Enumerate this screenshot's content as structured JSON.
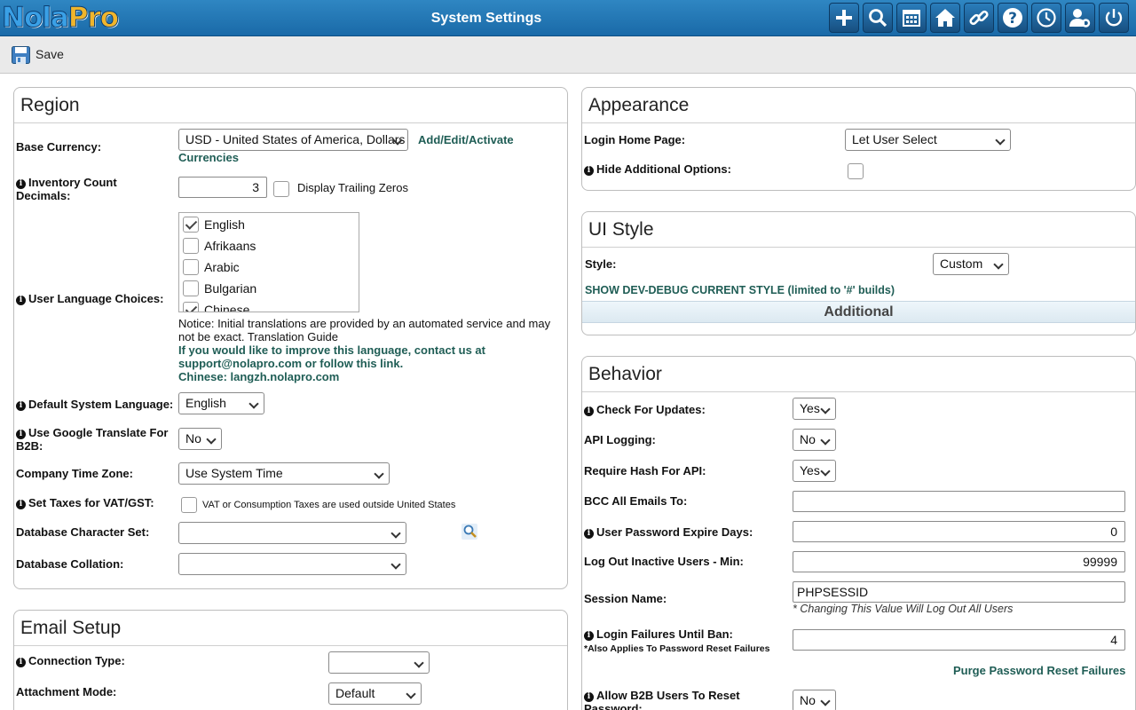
{
  "header": {
    "logo_part1": "Nola",
    "logo_part2": "Pro",
    "title": "System Settings",
    "icons": [
      "plus-icon",
      "search-icon",
      "calendar-icon",
      "home-icon",
      "link-icon",
      "help-icon",
      "clock-icon",
      "user-settings-icon",
      "power-icon"
    ]
  },
  "toolbar": {
    "save_label": "Save"
  },
  "region": {
    "title": "Region",
    "base_currency_label": "Base Currency:",
    "base_currency_value": "USD - United States of America, Dollars",
    "currencies_link_1": "Add/Edit/Activate",
    "currencies_link_2": "Currencies",
    "inventory_label_1": "Inventory Count",
    "inventory_label_2": "Decimals:",
    "inventory_value": "3",
    "trailing_zeros_label": "Display Trailing Zeros",
    "user_lang_label": "User Language Choices:",
    "languages": [
      {
        "name": "English",
        "checked": true
      },
      {
        "name": "Afrikaans",
        "checked": false
      },
      {
        "name": "Arabic",
        "checked": false
      },
      {
        "name": "Bulgarian",
        "checked": false
      },
      {
        "name": "Chinese",
        "checked": true
      }
    ],
    "notice_1": "Notice: Initial translations are provided by an automated service and may",
    "notice_2": "not be exact. Translation Guide",
    "improve_1": "If you would like to improve this language, contact us at",
    "improve_2": "support@nolapro.com or follow this link.",
    "improve_3": "Chinese: langzh.nolapro.com",
    "default_lang_label": "Default System Language:",
    "default_lang_value": "English",
    "google_label_1": "Use Google Translate For",
    "google_label_2": "B2B:",
    "google_value": "No",
    "timezone_label": "Company Time Zone:",
    "timezone_value": "Use System Time",
    "vat_label": "Set Taxes for VAT/GST:",
    "vat_note": "VAT or Consumption Taxes are used outside United States",
    "charset_label": "Database Character Set:",
    "charset_value": "",
    "collation_label": "Database Collation:",
    "collation_value": ""
  },
  "email": {
    "title": "Email Setup",
    "conn_label": "Connection Type:",
    "conn_value": "",
    "attach_label": "Attachment Mode:",
    "attach_value": "Default"
  },
  "appearance": {
    "title": "Appearance",
    "login_home_label": "Login Home Page:",
    "login_home_value": "Let User Select",
    "hide_opts_label": "Hide Additional Options:"
  },
  "ui_style": {
    "title": "UI Style",
    "style_label": "Style:",
    "style_value": "Custom",
    "debug_link": "SHOW DEV-DEBUG CURRENT STYLE (limited to '#' builds)",
    "additional": "Additional"
  },
  "behavior": {
    "title": "Behavior",
    "updates_label": "Check For Updates:",
    "updates_value": "Yes",
    "api_log_label": "API Logging:",
    "api_log_value": "No",
    "hash_label": "Require Hash For API:",
    "hash_value": "Yes",
    "bcc_label": "BCC All Emails To:",
    "bcc_value": "",
    "pwd_expire_label": "User Password Expire Days:",
    "pwd_expire_value": "0",
    "logout_label": "Log Out Inactive Users - Min:",
    "logout_value": "99999",
    "session_label": "Session Name:",
    "session_value": "PHPSESSID",
    "session_note": "* Changing This Value Will Log Out All Users",
    "login_fail_label": "Login Failures Until Ban:",
    "login_fail_note": "*Also Applies To Password Reset Failures",
    "login_fail_value": "4",
    "purge_link": "Purge Password Reset Failures",
    "b2b_reset_label_1": "Allow B2B Users To Reset",
    "b2b_reset_label_2": "Password:",
    "b2b_reset_value": "No"
  }
}
